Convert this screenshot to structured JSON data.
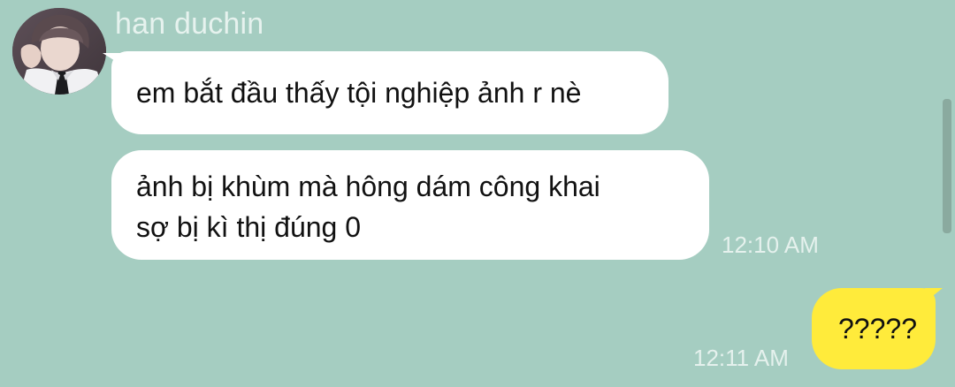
{
  "conversation": {
    "contact": {
      "name": "han duchin",
      "avatar_icon": "profile-photo"
    },
    "messages": [
      {
        "direction": "incoming",
        "text": "em bắt đầu thấy tội nghiệp ảnh r nè"
      },
      {
        "direction": "incoming",
        "line1": "ảnh bị khùm mà hông dám công khai",
        "line2": "sợ bị kì thị đúng 0",
        "time": "12:10 AM"
      },
      {
        "direction": "outgoing",
        "text": "?????",
        "time": "12:11 AM"
      }
    ]
  },
  "colors": {
    "background": "#a5cdc1",
    "incoming_bubble": "#ffffff",
    "outgoing_bubble": "#ffeb3b",
    "meta_text": "#e5f1ed"
  }
}
